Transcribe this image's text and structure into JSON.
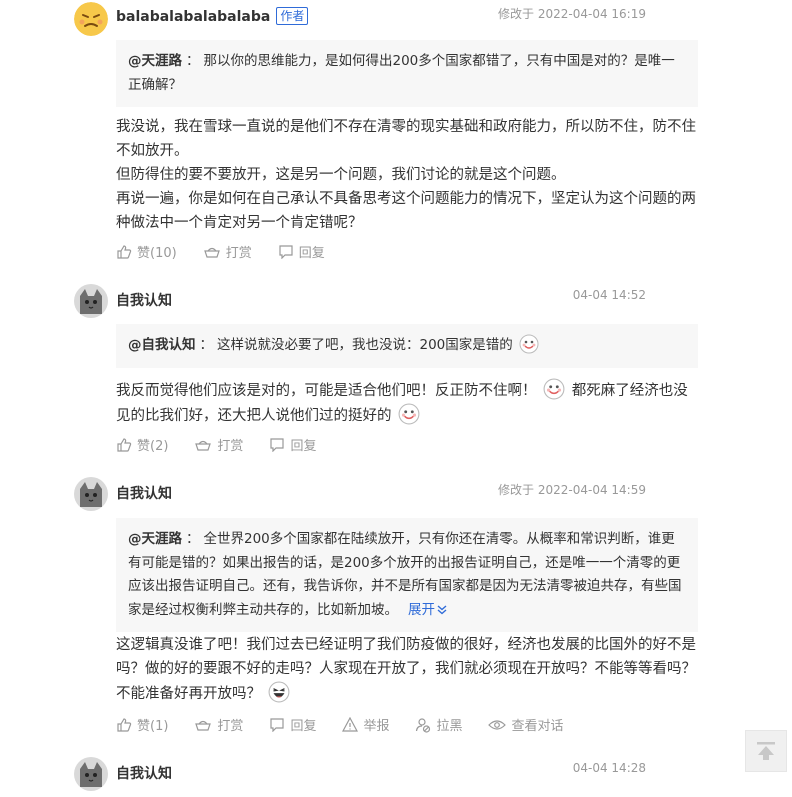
{
  "comments": [
    {
      "username": "balabalabalabalaba",
      "author_tag": "作者",
      "time": "修改于 2022-04-04 16:19",
      "quote_user": "@天涯路",
      "quote_sep": "：",
      "quote_text": "那以你的思维能力，是如何得出200多个国家都错了，只有中国是对的？是唯一正确解？",
      "lines": [
        "我没说，我在雪球一直说的是他们不存在清零的现实基础和政府能力，所以防不住，防不住不如放开。",
        "但防得住的要不要放开，这是另一个问题，我们讨论的就是这个问题。",
        "再说一遍，你是如何在自己承认不具备思考这个问题能力的情况下，坚定认为这个问题的两种做法中一个肯定对另一个肯定错呢？"
      ],
      "like_label": "赞(10)",
      "tip_label": "打赏",
      "reply_label": "回复"
    },
    {
      "username": "自我认知",
      "time": "04-04 14:52",
      "quote_user": "@自我认知",
      "quote_sep": "：",
      "quote_text": "这样说就没必要了吧，我也没说：200国家是错的",
      "text_a": "我反而觉得他们应该是对的，可能是适合他们吧！反正防不住啊！",
      "text_b": "都死麻了经济也没见的比我们好，还大把人说他们过的挺好的",
      "like_label": "赞(2)",
      "tip_label": "打赏",
      "reply_label": "回复"
    },
    {
      "username": "自我认知",
      "time": "修改于 2022-04-04 14:59",
      "quote_user": "@天涯路",
      "quote_sep": "：",
      "quote_text": "全世界200多个国家都在陆续放开，只有你还在清零。从概率和常识判断，谁更有可能是错的？如果出报告的话，是200多个放开的出报告证明自己，还是唯一一个清零的更应该出报告证明自己。还有，我告诉你，并不是所有国家都是因为无法清零被迫共存，有些国家是经过权衡利弊主动共存的，比如新加坡。",
      "expand_label": "展开",
      "text": "这逻辑真没谁了吧！我们过去已经证明了我们防疫做的很好，经济也发展的比国外的好不是吗？做的好的要跟不好的走吗？人家现在开放了，我们就必须现在开放吗？不能等等看吗？不能准备好再开放吗？",
      "like_label": "赞(1)",
      "tip_label": "打赏",
      "reply_label": "回复",
      "report_label": "举报",
      "block_label": "拉黑",
      "view_label": "查看对话"
    },
    {
      "username": "自我认知",
      "time": "04-04 14:28"
    }
  ],
  "colors": {
    "link": "#2f6bd8",
    "muted": "#999999",
    "quote_bg": "#f7f7f7"
  },
  "icons": [
    "angry-face-avatar",
    "cat-avatar",
    "thumbs-up-icon",
    "tip-icon",
    "reply-icon",
    "report-icon",
    "block-icon",
    "view-conversation-icon",
    "back-to-top-icon",
    "smiley-emoji",
    "laughing-emoji"
  ]
}
